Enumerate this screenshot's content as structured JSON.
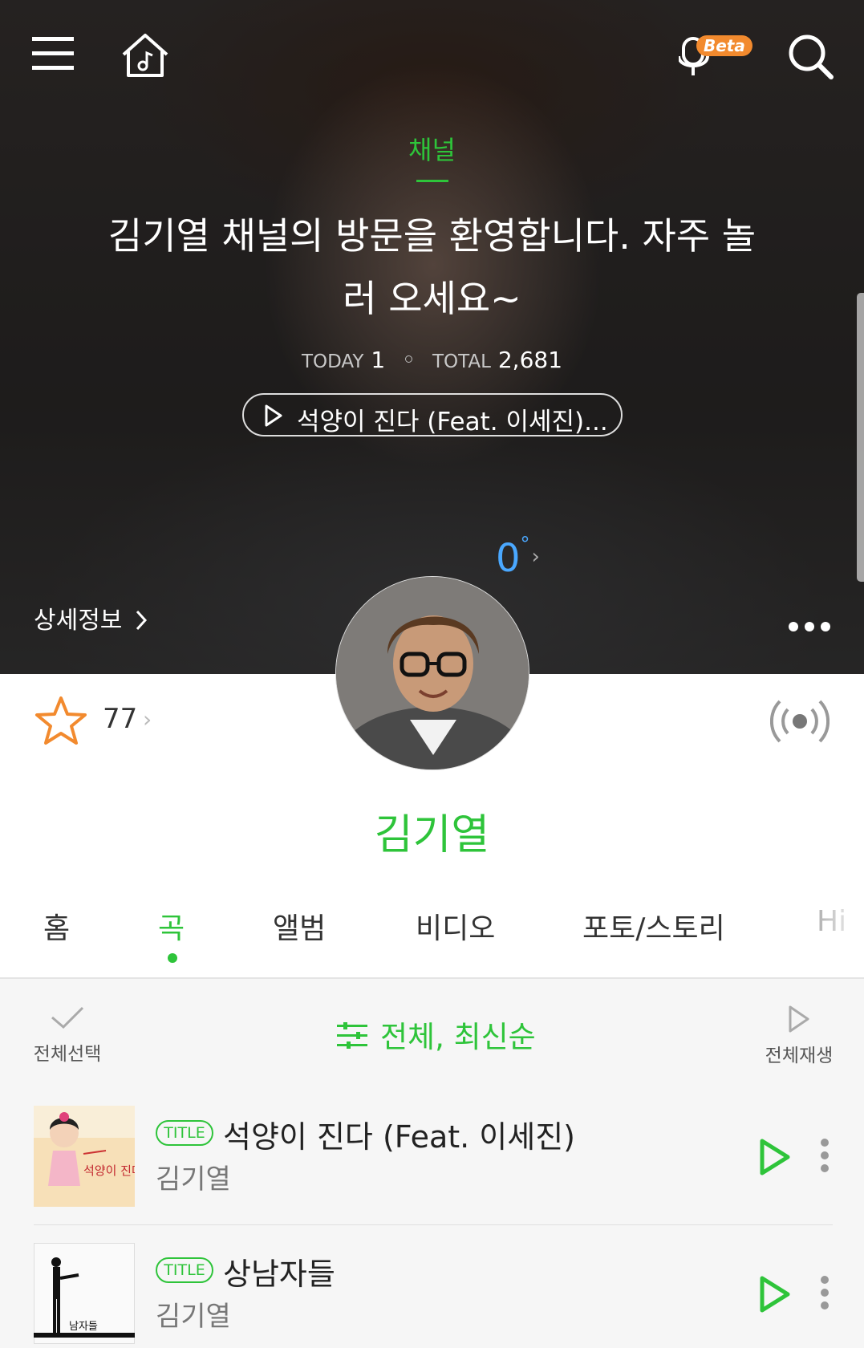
{
  "header": {
    "channel_label": "채널",
    "welcome_message": "김기열 채널의 방문을 환영합니다. 자주 놀러 오세요~",
    "today_label": "TODAY",
    "today_count": "1",
    "total_label": "TOTAL",
    "total_count": "2,681",
    "featured_song": "석양이 진다 (Feat. 이세진)...",
    "beta_badge": "Beta",
    "temperature": "0",
    "temperature_unit": "°",
    "detail_link": "상세정보"
  },
  "profile": {
    "favorite_count": "77",
    "artist_name": "김기열"
  },
  "tabs": [
    {
      "label": "홈",
      "active": false
    },
    {
      "label": "곡",
      "active": true
    },
    {
      "label": "앨범",
      "active": false
    },
    {
      "label": "비디오",
      "active": false
    },
    {
      "label": "포토/스토리",
      "active": false
    },
    {
      "label": "Hi",
      "active": false
    }
  ],
  "toolbar": {
    "select_all": "전체선택",
    "filter": "전체, 최신순",
    "play_all": "전체재생"
  },
  "songs": [
    {
      "badge": "TITLE",
      "title": "석양이 진다 (Feat. 이세진)",
      "artist": "김기열"
    },
    {
      "badge": "TITLE",
      "title": "상남자들",
      "artist": "김기열"
    }
  ],
  "album_art_text": {
    "album1_title": "석양이 진다",
    "album2_title": "남자들"
  },
  "colors": {
    "accent": "#2ec43a",
    "star": "#f28a2e",
    "beta": "#f28a2e",
    "temperature": "#4aa8ff"
  },
  "icons": [
    "menu-icon",
    "home-music-icon",
    "voice-search-beta-icon",
    "search-icon",
    "play-icon",
    "more-dots-icon",
    "star-icon",
    "radio-broadcast-icon",
    "checkmark-icon",
    "filter-sliders-icon",
    "kebab-icon"
  ]
}
